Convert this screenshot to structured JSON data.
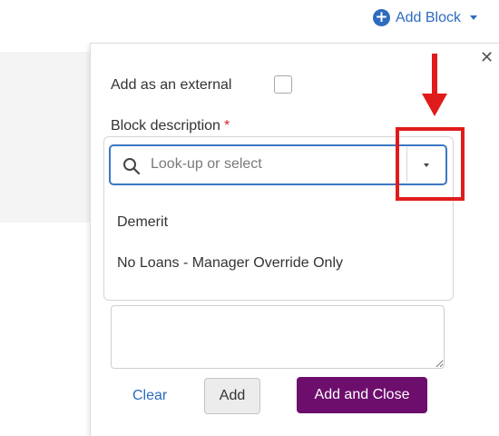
{
  "header": {
    "add_block_label": "Add Block",
    "add_block_icon": "plus-circle-icon",
    "accent_color": "#2e6bbd"
  },
  "dialog": {
    "close_icon": "close-icon",
    "external_label": "Add as an external",
    "external_checked": false,
    "description_label": "Block description",
    "required_mark": "*",
    "search_placeholder": "Look-up or select",
    "options": [
      {
        "label": "Demerit"
      },
      {
        "label": "No Loans - Manager Override Only"
      }
    ],
    "textarea_value": "",
    "buttons": {
      "clear": "Clear",
      "add": "Add",
      "add_and_close": "Add and Close"
    },
    "primary_color": "#6d0e6d"
  },
  "annotation": {
    "highlight_color": "#e01b1b"
  }
}
